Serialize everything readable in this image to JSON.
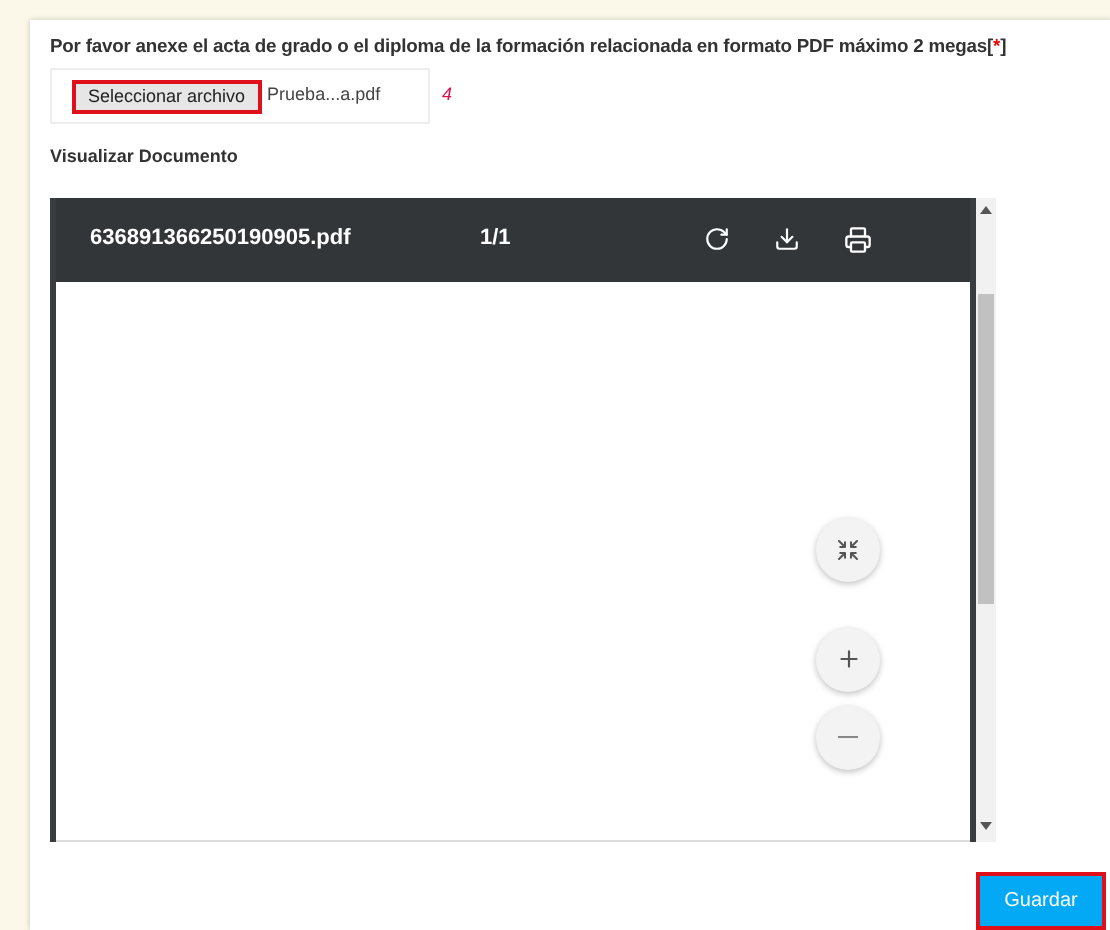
{
  "instruction": {
    "text": "Por favor anexe el acta de grado o el diploma de la formación relacionada en formato PDF máximo 2 megas",
    "required_mark": {
      "open": "[",
      "mark": "*",
      "close": "]"
    }
  },
  "file_input": {
    "button": "Seleccionar archivo",
    "file_name": "Prueba...a.pdf",
    "annotation": "4"
  },
  "preview_heading": "Visualizar Documento",
  "pdf_viewer": {
    "file_name": "636891366250190905.pdf",
    "page": "1/1"
  },
  "save_button": "Guardar"
}
